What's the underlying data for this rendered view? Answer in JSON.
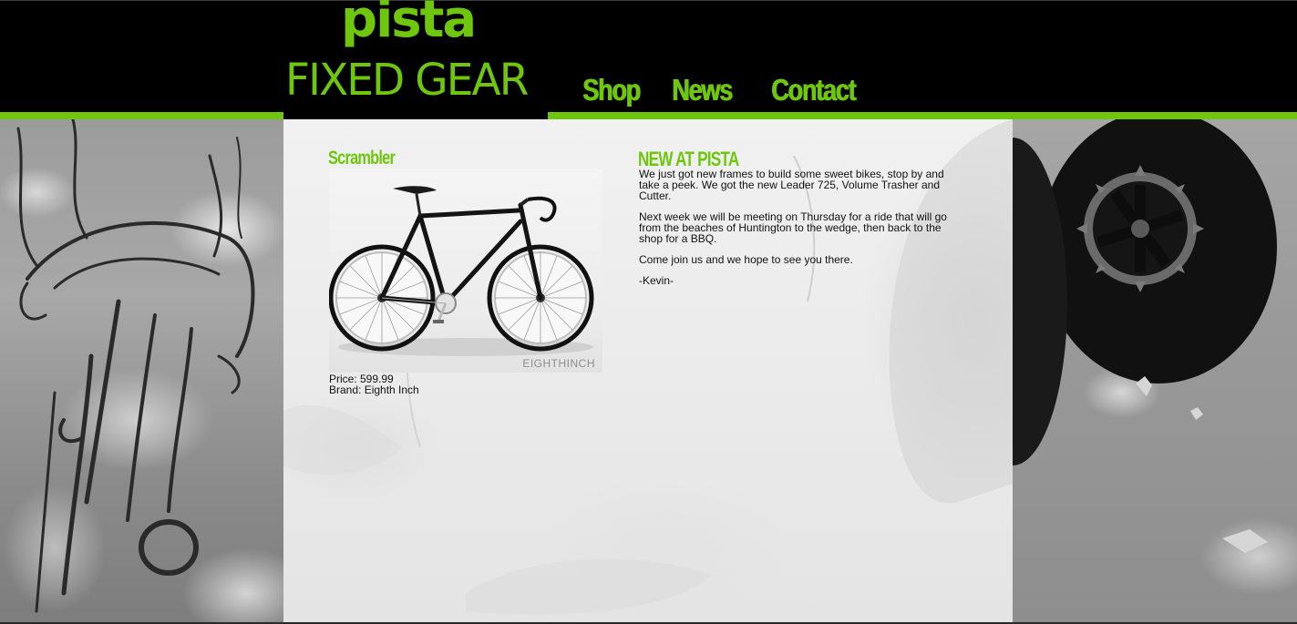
{
  "brand": {
    "logo_line1": "pista",
    "logo_line2": "FIXED GEAR",
    "accent_color": "#6fc70d"
  },
  "nav": {
    "items": [
      {
        "label": "Shop"
      },
      {
        "label": "News"
      },
      {
        "label": "Contact"
      }
    ]
  },
  "product": {
    "title": "Scrambler",
    "image_watermark": "EIGHTHINCH",
    "price_line": "Price: 599.99",
    "brand_line": "Brand: Eighth Inch"
  },
  "news": {
    "title": "NEW AT PISTA",
    "paragraphs": [
      "We just got new frames to build some sweet bikes, stop by and take a peek. We got the new Leader 725, Volume Trasher and Cutter.",
      "Next week we will be meeting on Thursday for a ride that will go from the beaches of Huntington to the wedge, then back to the shop for a BBQ.",
      "Come join us and we hope to see you there.",
      "-Kevin-"
    ]
  }
}
